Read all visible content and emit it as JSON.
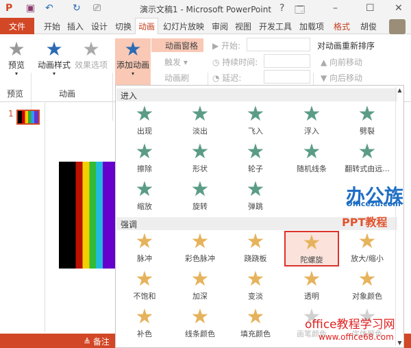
{
  "title": "演示文稿1 - Microsoft PowerPoint",
  "window_controls": {
    "help": "?",
    "restore": "🗔",
    "min": "–",
    "max": "☐",
    "close": "✕"
  },
  "tabs": [
    "文件",
    "开始",
    "插入",
    "设计",
    "切换",
    "动画",
    "幻灯片放映",
    "审阅",
    "视图",
    "开发工具",
    "加载项",
    "格式"
  ],
  "user": "胡俊",
  "ribbon": {
    "preview": "预览",
    "anim_styles": "动画样式",
    "effect_opts": "效果选项",
    "add_anim": "添加动画",
    "anim_pane": "动画窗格",
    "trigger": "触发",
    "anim_painter": "动画刷",
    "start": "开始:",
    "duration": "持续时间:",
    "delay": "延迟:",
    "reorder": "对动画重新排序",
    "move_earlier": "向前移动",
    "move_later": "向后移动",
    "group_preview": "预览",
    "group_anim": "动画"
  },
  "slide_number": "1",
  "status": {
    "notes": "备注"
  },
  "gallery": {
    "entrance_header": "进入",
    "entrance": [
      "出现",
      "淡出",
      "飞入",
      "浮入",
      "劈裂",
      "擦除",
      "形状",
      "轮子",
      "随机线条",
      "翻转式由远...",
      "缩放",
      "旋转",
      "弹跳"
    ],
    "emphasis_header": "强调",
    "emphasis": [
      "脉冲",
      "彩色脉冲",
      "跷跷板",
      "陀螺旋",
      "放大/缩小",
      "不饱和",
      "加深",
      "变淡",
      "透明",
      "对象颜色",
      "补色",
      "线条颜色",
      "填充颜色",
      "画笔颜色",
      "字体颜色"
    ],
    "selected": "陀螺旋",
    "disabled": [
      "画笔颜色",
      "字体颜色"
    ]
  },
  "watermarks": {
    "logo1": "办公族",
    "logo1_url": "Officezu.com",
    "logo1_sub": "PPT教程",
    "logo2": "office教程学习网",
    "logo2_url": "www.office68.com"
  },
  "colors": {
    "accent": "#d24726",
    "entrance": "#5b9c86",
    "emphasis": "#e6b35c",
    "selected_border": "#d9332a"
  }
}
